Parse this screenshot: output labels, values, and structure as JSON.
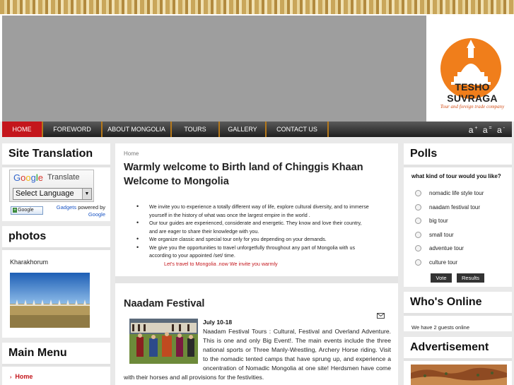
{
  "brand": {
    "name": "TESHO SUVRAGA",
    "tagline": "Tour and foreign trade company"
  },
  "nav": {
    "items": [
      "HOME",
      "FOREWORD",
      "ABOUT MONGOLIA",
      "TOURS",
      "GALLERY",
      "CONTACT US"
    ],
    "active_index": 0,
    "font_sizer": [
      "a",
      "a",
      "a"
    ]
  },
  "left": {
    "translation": {
      "title": "Site Translation",
      "google_text": "Google",
      "translate_label": "Translate",
      "select_label": "Select Language",
      "plus_button": "Google",
      "gadgets_link": "Gadgets",
      "powered_by": "powered by",
      "powered_google": "Google"
    },
    "photos": {
      "title": "photos",
      "caption": "Kharakhorum"
    },
    "main_menu": {
      "title": "Main Menu",
      "items": [
        "Home"
      ]
    }
  },
  "main": {
    "breadcrumb": "Home",
    "heading_line1": "Warmly welcome to Birth land of Chinggis Khaan",
    "heading_line2": "Welcome to Mongolia",
    "bullets": [
      "We invite you to experience a totally different way of life, explore cultural diversity, and to immerse yourself in the history of what was once the largest empire in the world .",
      "Our tour guides are experienced, considerate and energetic. They know and love their country, and are eager to share their knowledge with you.",
      "We organize classic and special tour only for you depending on your demands.",
      "We give you the opportunities to travel unforgetfully throughout any part of Mongolia with us according to your appointed /set/ time."
    ],
    "invite_line": "Let's travel to Mongolia .now We invite you warmly",
    "article": {
      "title": "Naadam Festival",
      "date": "July 10-18",
      "body": "Naadam Festival Tours : Cultural, Festival and Overland Adventure. This is one and only Big Event!. The main events include the three national sports or Three Manly-Wrestling, Archery Horse riding. Visit to the nomadic tented camps that have sprung up, and experience a oncentration of Nomadic Mongolia at one site! Herdsmen have come with their horses and all provisions for the festivities."
    }
  },
  "right": {
    "polls": {
      "title": "Polls",
      "question": "what kind of tour would you like?",
      "options": [
        "nomadic life style tour",
        "naadam festival tour",
        "big tour",
        "small tour",
        "adventue tour",
        "culture tour"
      ],
      "vote_label": "Vote",
      "results_label": "Results"
    },
    "whos_online": {
      "title": "Who's Online",
      "text": "We have 2 guests online"
    },
    "advertisement": {
      "title": "Advertisement"
    }
  },
  "colors": {
    "accent_red": "#c4161c",
    "nav_dark": "#2a2a2a",
    "logo_orange": "#f07e1b"
  }
}
